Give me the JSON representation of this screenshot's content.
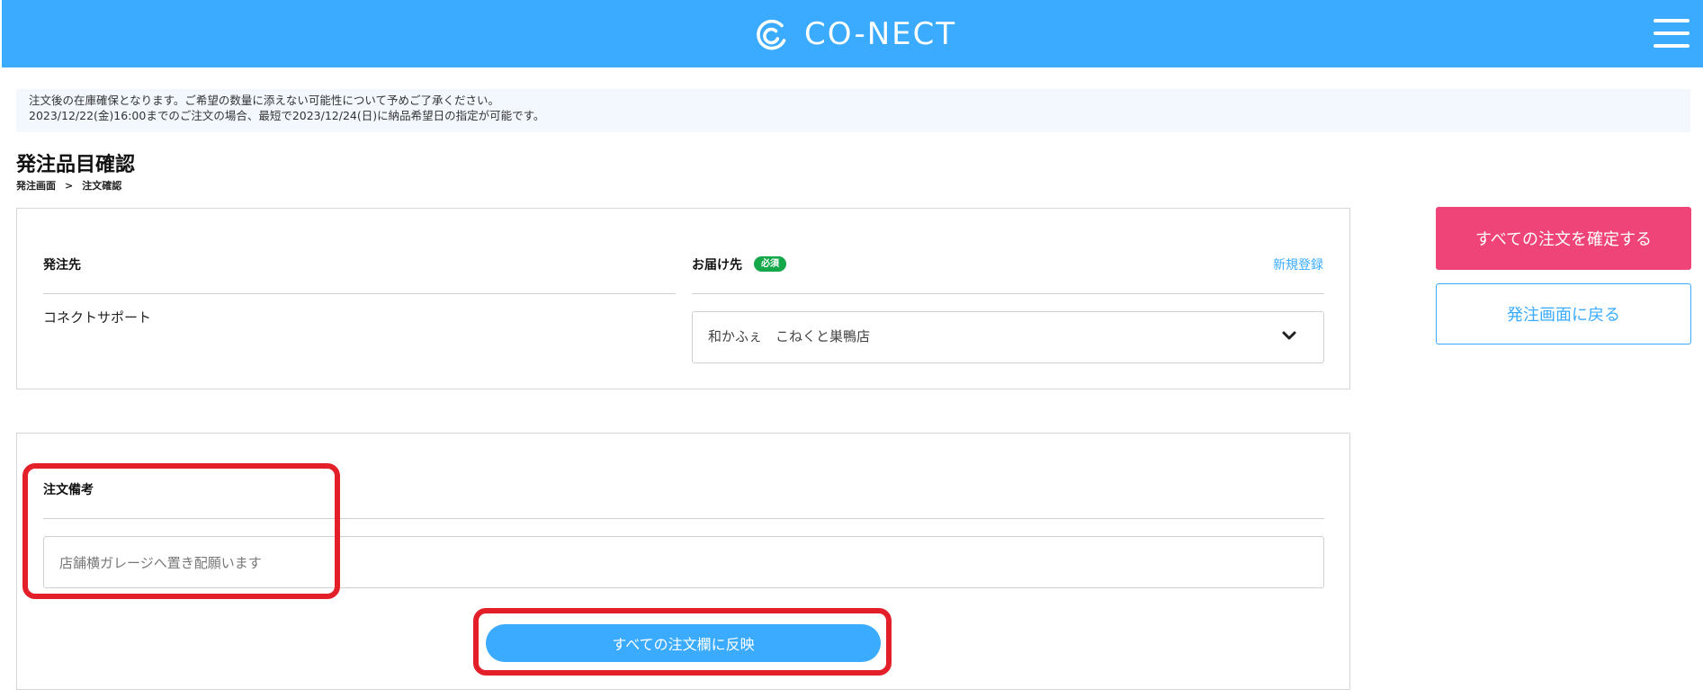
{
  "header": {
    "logo_text": "CO-NECT",
    "brand_color": "#3aabff",
    "menu_icon": "hamburger-menu-icon"
  },
  "notice": {
    "line1": "注文後の在庫確保となります。ご希望の数量に添えない可能性について予めご了承ください。",
    "line2": "2023/12/22(金)16:00までのご注文の場合、最短で2023/12/24(日)に納品希望日の指定が可能です。"
  },
  "page": {
    "title": "発注品目確認",
    "breadcrumb": [
      "発注画面",
      "注文確認"
    ],
    "breadcrumb_separator": ">"
  },
  "order_card": {
    "supplier_label": "発注先",
    "supplier_value": "コネクトサポート",
    "delivery_label": "お届け先",
    "required_badge": "必須",
    "register_link": "新規登録",
    "delivery_selected": "和かふぇ　こねくと巣鴨店"
  },
  "remarks_card": {
    "label": "注文備考",
    "input_value": "店舗横ガレージへ置き配願います",
    "apply_all_button": "すべての注文欄に反映"
  },
  "sidebar": {
    "confirm_all_button": "すべての注文を確定する",
    "back_button": "発注画面に戻る",
    "confirm_color": "#ee4478"
  },
  "colors": {
    "required_badge": "#14a84a",
    "highlight": "#e3202a"
  }
}
